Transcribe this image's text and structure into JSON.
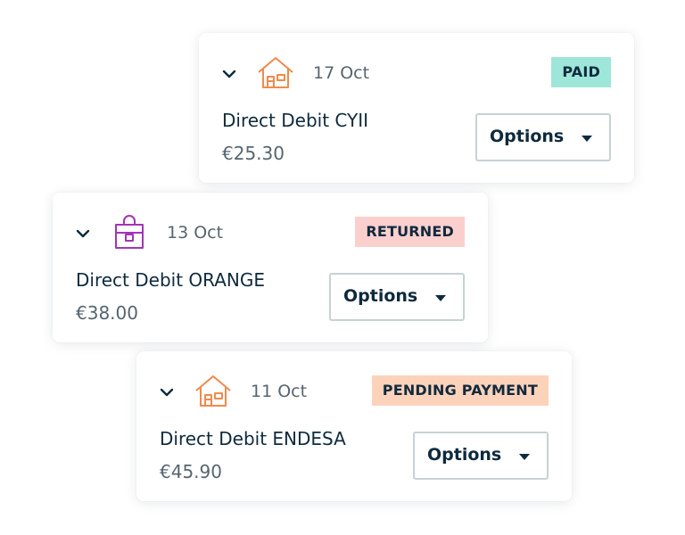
{
  "payments": [
    {
      "date": "17 Oct",
      "status": "PAID",
      "status_color": "#9ee6d9",
      "icon": "house-icon",
      "icon_color": "#f08a4b",
      "title": "Direct Debit CYII",
      "amount": "€25.30",
      "options_label": "Options"
    },
    {
      "date": "13 Oct",
      "status": "RETURNED",
      "status_color": "#fccfcf",
      "icon": "shopping-bag-icon",
      "icon_color": "#a334b8",
      "title": "Direct Debit ORANGE",
      "amount": "€38.00",
      "options_label": "Options"
    },
    {
      "date": "11 Oct",
      "status": "PENDING PAYMENT",
      "status_color": "#fdd2bb",
      "icon": "house-icon",
      "icon_color": "#f08a4b",
      "title": "Direct Debit ENDESA",
      "amount": "€45.90",
      "options_label": "Options"
    }
  ]
}
